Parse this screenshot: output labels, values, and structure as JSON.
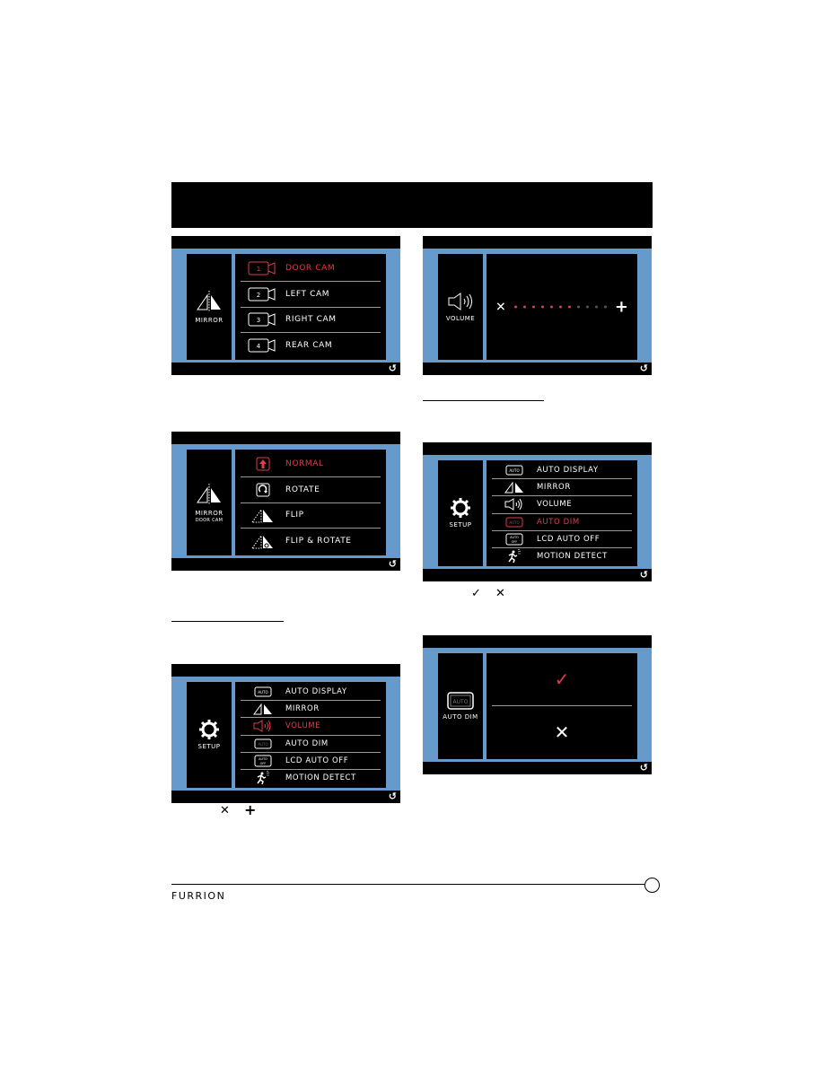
{
  "colors": {
    "accent": "#e03c4a",
    "screen_frame": "#6699cc",
    "screen_bg": "#000000"
  },
  "screens": {
    "camera_select": {
      "side_label": "MIRROR",
      "side_icon": "mirror-icon",
      "items": [
        {
          "num": "1",
          "label": "DOOR CAM",
          "selected": true
        },
        {
          "num": "2",
          "label": "LEFT CAM",
          "selected": false
        },
        {
          "num": "3",
          "label": "RIGHT CAM",
          "selected": false
        },
        {
          "num": "4",
          "label": "REAR CAM",
          "selected": false
        }
      ],
      "back_icon": "return-icon"
    },
    "volume": {
      "side_label": "VOLUME",
      "side_icon": "speaker-icon",
      "minus_symbol": "✕",
      "plus_symbol": "+",
      "level": 7,
      "max": 11
    },
    "mirror_mode": {
      "side_label": "MIRROR",
      "side_sublabel": "DOOR CAM",
      "items": [
        {
          "label": "NORMAL",
          "icon": "arrow-up-icon",
          "selected": true
        },
        {
          "label": "ROTATE",
          "icon": "rotate-icon",
          "selected": false
        },
        {
          "label": "FLIP",
          "icon": "flip-icon",
          "selected": false
        },
        {
          "label": "FLIP & ROTATE",
          "icon": "flip-rotate-icon",
          "selected": false
        }
      ]
    },
    "setup_autodim": {
      "side_label": "SETUP",
      "items": [
        {
          "label": "AUTO DISPLAY",
          "selected": false
        },
        {
          "label": "MIRROR",
          "selected": false
        },
        {
          "label": "VOLUME",
          "selected": false
        },
        {
          "label": "AUTO DIM",
          "selected": true
        },
        {
          "label": "LCD AUTO OFF",
          "selected": false
        },
        {
          "label": "MOTION DETECT",
          "selected": false
        }
      ]
    },
    "setup_volume": {
      "side_label": "SETUP",
      "items": [
        {
          "label": "AUTO DISPLAY",
          "selected": false
        },
        {
          "label": "MIRROR",
          "selected": false
        },
        {
          "label": "VOLUME",
          "selected": true
        },
        {
          "label": "AUTO DIM",
          "selected": false
        },
        {
          "label": "LCD AUTO OFF",
          "selected": false
        },
        {
          "label": "MOTION DETECT",
          "selected": false
        }
      ]
    },
    "autodim_toggle": {
      "side_label": "AUTO DIM",
      "icon_text": "AUTO",
      "on_symbol": "✓",
      "off_symbol": "✕"
    }
  },
  "inline_symbols": {
    "volume_keys": [
      "✕",
      "+"
    ],
    "confirm_keys": [
      "✓",
      "✕"
    ]
  },
  "footer": {
    "brand": "FURRION"
  }
}
